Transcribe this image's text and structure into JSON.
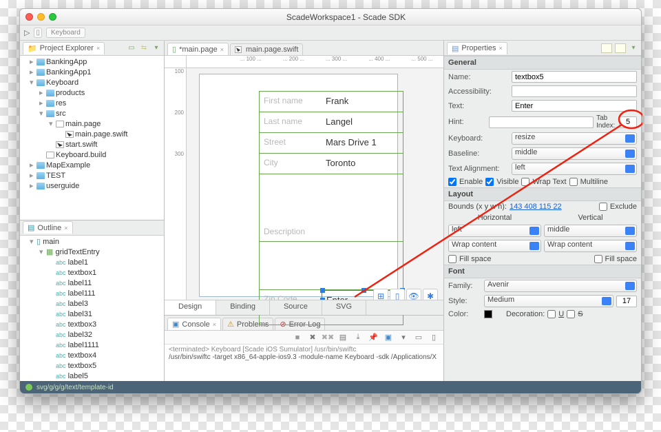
{
  "title": "ScadeWorkspace1 - Scade SDK",
  "toolbar": {
    "keyboard": "Keyboard"
  },
  "projectExplorer": {
    "tab": "Project Explorer",
    "items": {
      "bankingApp": "BankingApp",
      "bankingApp1": "BankingApp1",
      "keyboard": "Keyboard",
      "products": "products",
      "res": "res",
      "src": "src",
      "mainPage": "main.page",
      "mainPageSwift": "main.page.swift",
      "startSwift": "start.swift",
      "keyboardBuild": "Keyboard.build",
      "mapExample": "MapExample",
      "test": "TEST",
      "userguide": "userguide"
    }
  },
  "outline": {
    "tab": "Outline",
    "root": "main",
    "grid": "gridTextEntry",
    "items": [
      "label1",
      "textbox1",
      "label11",
      "label111",
      "label3",
      "label31",
      "textbox3",
      "label32",
      "label1111",
      "textbox4",
      "textbox5",
      "label5"
    ]
  },
  "editor": {
    "tab1": "*main.page",
    "tab2": "main.page.swift",
    "rulerTop": [
      "100",
      "200",
      "300",
      "400",
      "500"
    ],
    "rulerLeft": [
      "100",
      "200",
      "300"
    ],
    "designTabs": {
      "design": "Design",
      "binding": "Binding",
      "source": "Source",
      "svg": "SVG"
    },
    "fields": {
      "firstName": {
        "label": "First name",
        "value": "Frank"
      },
      "lastName": {
        "label": "Last name",
        "value": "Langel"
      },
      "street": {
        "label": "Street",
        "value": "Mars Drive 1"
      },
      "city": {
        "label": "City",
        "value": "Toronto"
      },
      "description": {
        "label": "Description",
        "value": ""
      },
      "zip": {
        "label": "Zip Code",
        "value": "Enter"
      }
    }
  },
  "console": {
    "tab1": "Console",
    "tab2": "Problems",
    "tab3": "Error Log",
    "line1": "<terminated> Keyboard [Scade iOS Sumulator] /usr/bin/swiftc",
    "line2": "/usr/bin/swiftc -target x86_64-apple-ios9.3 -module-name Keyboard -sdk /Applications/X"
  },
  "properties": {
    "tab": "Properties",
    "general": "General",
    "nameLabel": "Name:",
    "name": "textbox5",
    "accessLabel": "Accessibility:",
    "textLabel": "Text:",
    "text": "Enter",
    "hintLabel": "Hint:",
    "tabIndexLabel": "Tab Index:",
    "tabIndex": "5",
    "keyboardLabel": "Keyboard:",
    "keyboard": "resize",
    "baselineLabel": "Baseline:",
    "baseline": "middle",
    "textAlignLabel": "Text Alignment:",
    "textAlign": "left",
    "enable": "Enable",
    "visible": "Visible",
    "wrapText": "Wrap Text",
    "multiline": "Multiline",
    "layout": "Layout",
    "boundsLabel": "Bounds (x y w h):",
    "bounds": "143 408 115 22",
    "exclude": "Exclude",
    "horizontal": "Horizontal",
    "vertical": "Vertical",
    "hAlign": "left",
    "vAlign": "middle",
    "hSize": "Wrap content",
    "vSize": "Wrap content",
    "fillSpace": "Fill space",
    "font": "Font",
    "familyLabel": "Family:",
    "family": "Avenir",
    "styleLabel": "Style:",
    "style": "Medium",
    "fontSize": "17",
    "colorLabel": "Color:",
    "decorationLabel": "Decoration:",
    "decU": "U",
    "decS": "S"
  },
  "status": "svg/g/g/g/text/template-id"
}
